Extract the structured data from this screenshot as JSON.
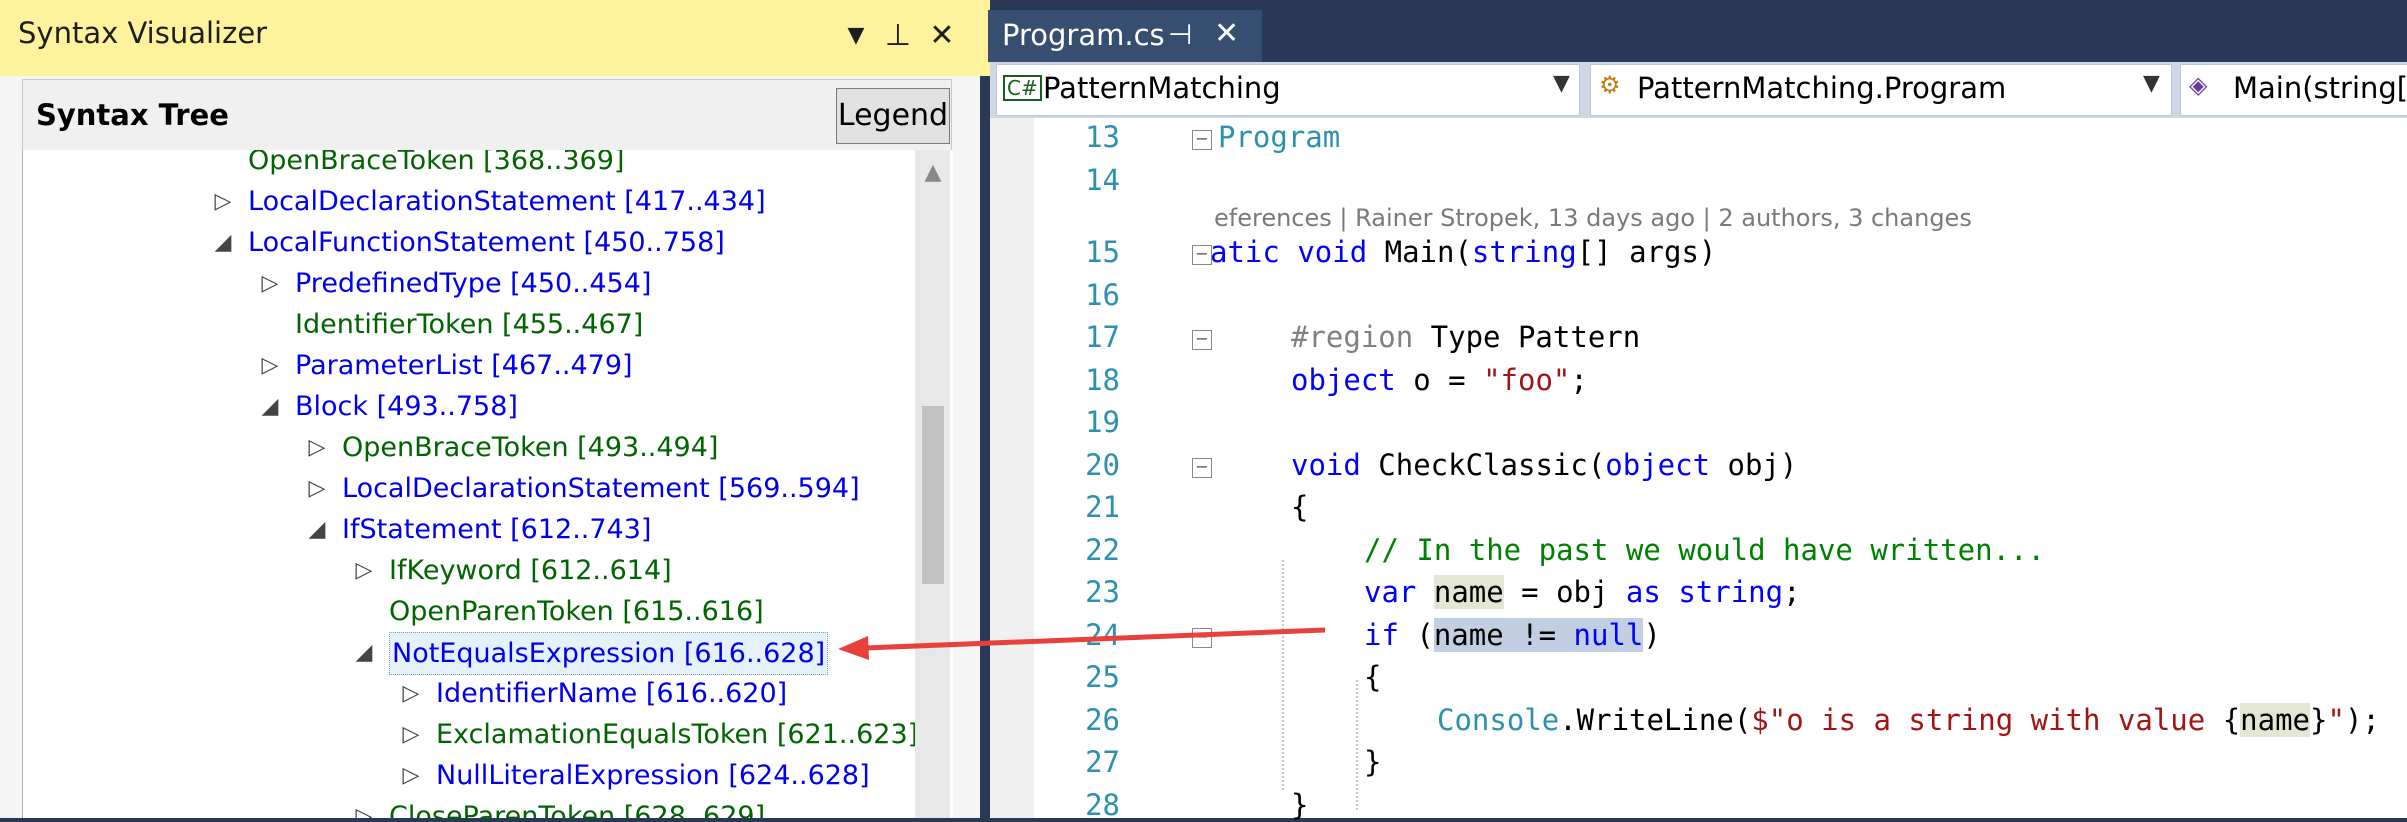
{
  "left_panel": {
    "title": "Syntax Visualizer",
    "section_title": "Syntax Tree",
    "legend_button": "Legend",
    "tree": [
      {
        "label": "OpenBraceToken [368..369]",
        "color": "green",
        "indent": 0,
        "expander": "none",
        "partial": true
      },
      {
        "label": "LocalDeclarationStatement [417..434]",
        "color": "blue",
        "indent": 0,
        "expander": "collapsed"
      },
      {
        "label": "LocalFunctionStatement [450..758]",
        "color": "blue",
        "indent": 0,
        "expander": "expanded"
      },
      {
        "label": "PredefinedType [450..454]",
        "color": "blue",
        "indent": 1,
        "expander": "collapsed"
      },
      {
        "label": "IdentifierToken [455..467]",
        "color": "green",
        "indent": 1,
        "expander": "none"
      },
      {
        "label": "ParameterList [467..479]",
        "color": "blue",
        "indent": 1,
        "expander": "collapsed"
      },
      {
        "label": "Block [493..758]",
        "color": "blue",
        "indent": 1,
        "expander": "expanded"
      },
      {
        "label": "OpenBraceToken [493..494]",
        "color": "green",
        "indent": 2,
        "expander": "collapsed"
      },
      {
        "label": "LocalDeclarationStatement [569..594]",
        "color": "blue",
        "indent": 2,
        "expander": "collapsed"
      },
      {
        "label": "IfStatement [612..743]",
        "color": "blue",
        "indent": 2,
        "expander": "expanded"
      },
      {
        "label": "IfKeyword [612..614]",
        "color": "green",
        "indent": 3,
        "expander": "collapsed"
      },
      {
        "label": "OpenParenToken [615..616]",
        "color": "green",
        "indent": 3,
        "expander": "none"
      },
      {
        "label": "NotEqualsExpression [616..628]",
        "color": "blue",
        "indent": 3,
        "expander": "expanded",
        "selected": true
      },
      {
        "label": "IdentifierName [616..620]",
        "color": "blue",
        "indent": 4,
        "expander": "collapsed"
      },
      {
        "label": "ExclamationEqualsToken [621..623]",
        "color": "green",
        "indent": 4,
        "expander": "collapsed"
      },
      {
        "label": "NullLiteralExpression [624..628]",
        "color": "blue",
        "indent": 4,
        "expander": "collapsed"
      },
      {
        "label": "CloseParenToken [628..629]",
        "color": "green",
        "indent": 3,
        "expander": "collapsed",
        "partial": true
      }
    ]
  },
  "editor": {
    "tab_title": "Program.cs",
    "nav": {
      "project": "PatternMatching",
      "type": "PatternMatching.Program",
      "member": "Main(string[]"
    },
    "codelens": "eferences | Rainer Stropek, 13 days ago | 2 authors, 3 changes",
    "lines": [
      {
        "n": "13",
        "text": "Program"
      },
      {
        "n": "14",
        "text": ""
      },
      {
        "n": "15",
        "text": "atic void Main(string[] args)"
      },
      {
        "n": "16",
        "text": ""
      },
      {
        "n": "17",
        "text": "#region Type Pattern"
      },
      {
        "n": "18",
        "text": "object o = \"foo\";"
      },
      {
        "n": "19",
        "text": ""
      },
      {
        "n": "20",
        "text": "void CheckClassic(object obj)"
      },
      {
        "n": "21",
        "text": "{"
      },
      {
        "n": "22",
        "text": "// In the past we would have written..."
      },
      {
        "n": "23",
        "text": "var name = obj as string;"
      },
      {
        "n": "24",
        "text": "if (name != null)"
      },
      {
        "n": "25",
        "text": "{"
      },
      {
        "n": "26",
        "text": "Console.WriteLine($\"o is a string with value {name}\");"
      },
      {
        "n": "27",
        "text": "}"
      },
      {
        "n": "28",
        "text": "}"
      }
    ]
  },
  "colors": {
    "title_bar": "#fff29d",
    "chrome": "#293955",
    "arrow": "#e8413c"
  }
}
